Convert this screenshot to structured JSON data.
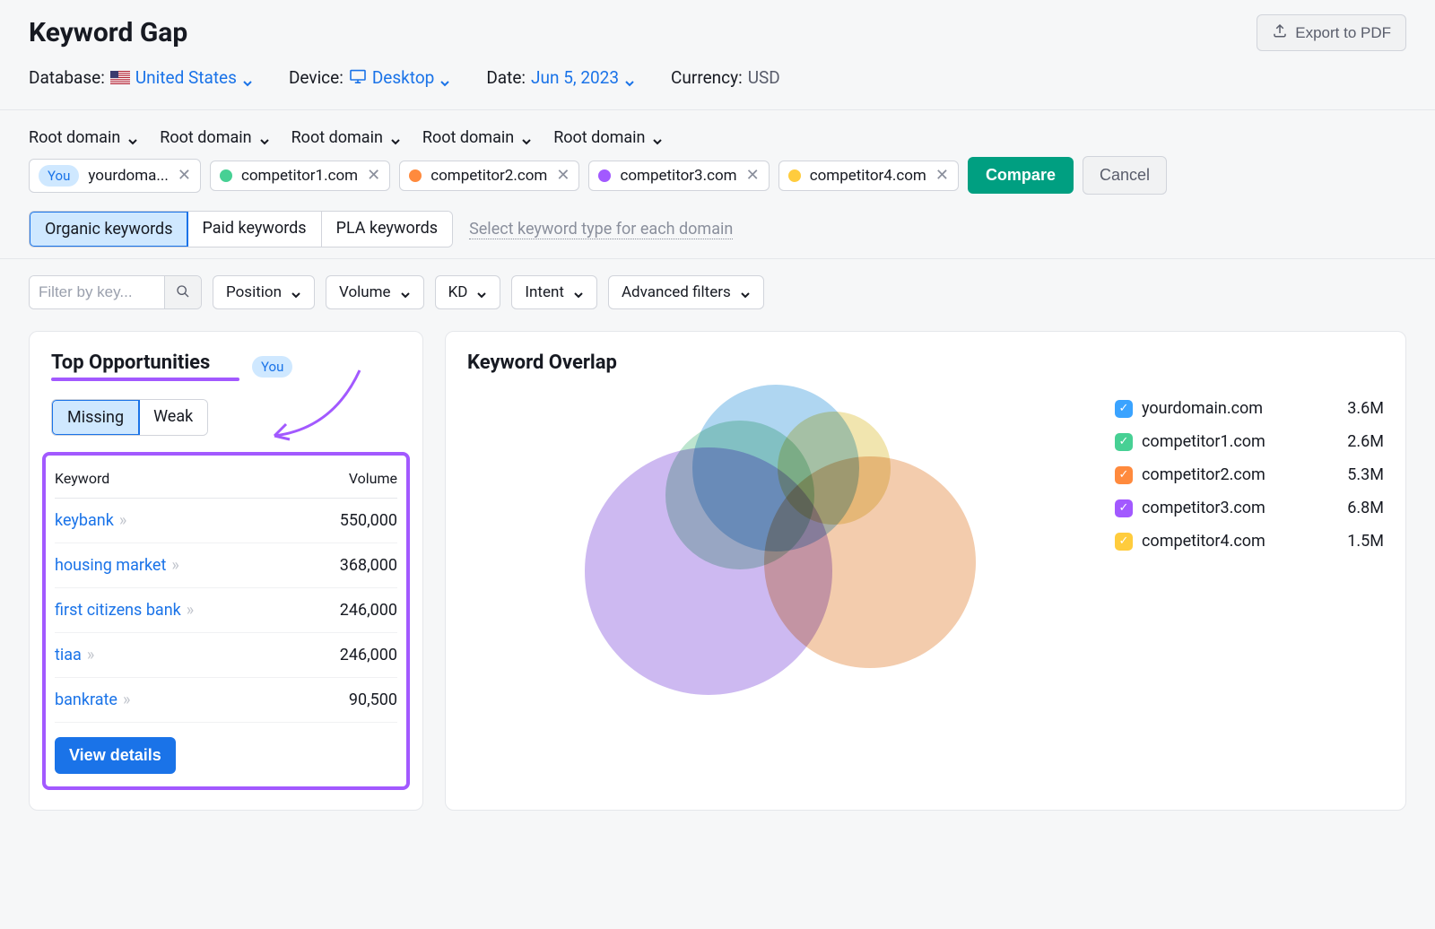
{
  "header": {
    "title": "Keyword Gap",
    "export": "Export to PDF",
    "database_label": "Database:",
    "database_value": "United States",
    "device_label": "Device:",
    "device_value": "Desktop",
    "date_label": "Date:",
    "date_value": "Jun 5, 2023",
    "currency_label": "Currency:",
    "currency_value": "USD"
  },
  "domain_selectors": [
    {
      "label": "Root domain"
    },
    {
      "label": "Root domain"
    },
    {
      "label": "Root domain"
    },
    {
      "label": "Root domain"
    },
    {
      "label": "Root domain"
    }
  ],
  "domains": [
    {
      "you": true,
      "you_label": "You",
      "label": "yourdoma...",
      "color": "#3aa3ff"
    },
    {
      "you": false,
      "label": "competitor1.com",
      "color": "#47d094"
    },
    {
      "you": false,
      "label": "competitor2.com",
      "color": "#ff8a3d"
    },
    {
      "you": false,
      "label": "competitor3.com",
      "color": "#a259ff"
    },
    {
      "you": false,
      "label": "competitor4.com",
      "color": "#ffcc3d"
    }
  ],
  "actions": {
    "compare": "Compare",
    "cancel": "Cancel"
  },
  "kw_types": {
    "organic": "Organic keywords",
    "paid": "Paid keywords",
    "pla": "PLA keywords",
    "link": "Select keyword type for each domain"
  },
  "filters": {
    "placeholder": "Filter by key...",
    "position": "Position",
    "volume": "Volume",
    "kd": "KD",
    "intent": "Intent",
    "advanced": "Advanced filters"
  },
  "opportunities": {
    "title": "Top Opportunities",
    "you_badge": "You",
    "tabs": {
      "missing": "Missing",
      "weak": "Weak"
    },
    "columns": {
      "keyword": "Keyword",
      "volume": "Volume"
    },
    "rows": [
      {
        "keyword": "keybank",
        "volume": "550,000"
      },
      {
        "keyword": "housing market",
        "volume": "368,000"
      },
      {
        "keyword": "first citizens bank",
        "volume": "246,000"
      },
      {
        "keyword": "tiaa",
        "volume": "246,000"
      },
      {
        "keyword": "bankrate",
        "volume": "90,500"
      }
    ],
    "view_details": "View details"
  },
  "overlap": {
    "title": "Keyword Overlap",
    "legend": [
      {
        "label": "yourdomain.com",
        "value": "3.6M",
        "color": "#3aa3ff"
      },
      {
        "label": "competitor1.com",
        "value": "2.6M",
        "color": "#47d094"
      },
      {
        "label": "competitor2.com",
        "value": "5.3M",
        "color": "#ff8a3d"
      },
      {
        "label": "competitor3.com",
        "value": "6.8M",
        "color": "#a259ff"
      },
      {
        "label": "competitor4.com",
        "value": "1.5M",
        "color": "#ffcc3d"
      }
    ]
  },
  "chart_data": {
    "type": "venn",
    "title": "Keyword Overlap",
    "series": [
      {
        "name": "yourdomain.com",
        "value": 3600000,
        "display": "3.6M",
        "color": "#3aa3ff"
      },
      {
        "name": "competitor1.com",
        "value": 2600000,
        "display": "2.6M",
        "color": "#47d094"
      },
      {
        "name": "competitor2.com",
        "value": 5300000,
        "display": "5.3M",
        "color": "#ff8a3d"
      },
      {
        "name": "competitor3.com",
        "value": 6800000,
        "display": "6.8M",
        "color": "#a259ff"
      },
      {
        "name": "competitor4.com",
        "value": 1500000,
        "display": "1.5M",
        "color": "#ffcc3d"
      }
    ]
  }
}
